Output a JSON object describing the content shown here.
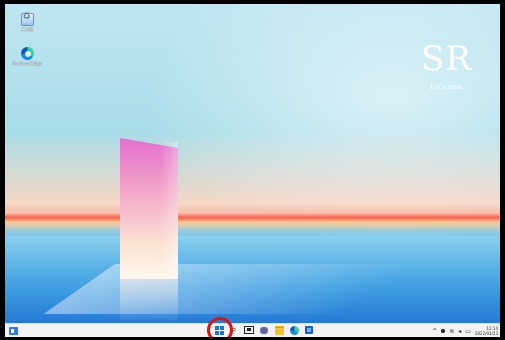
{
  "desktop": {
    "icons": [
      {
        "label": "ごみ箱",
        "icon": "recycle-bin-icon"
      },
      {
        "label": "Microsoft Edge",
        "icon": "edge-icon"
      }
    ],
    "logo": {
      "main": "SR",
      "sub": "Let's note"
    }
  },
  "taskbar": {
    "left_icon": "widgets-icon",
    "center_icons": [
      "start-icon",
      "search-icon",
      "task-view-icon",
      "chat-icon",
      "file-explorer-icon",
      "edge-icon",
      "store-icon"
    ],
    "tray": {
      "chevron": "^",
      "time": "12:14",
      "date": "2022/01/23"
    }
  },
  "colors": {
    "highlight": "#e01010",
    "start": "#1b74d8"
  }
}
